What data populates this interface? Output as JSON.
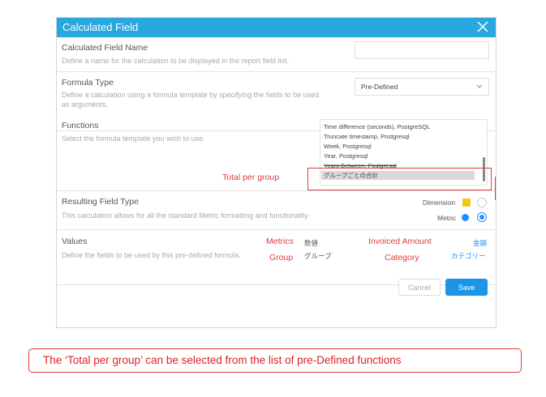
{
  "dialog": {
    "title": "Calculated Field",
    "close_icon": "close-icon",
    "accent_color": "#29a8e0"
  },
  "name_section": {
    "label": "Calculated Field Name",
    "description": "Define a name for the calculation to be displayed in the report field list.",
    "input_value": ""
  },
  "formula_section": {
    "label": "Formula Type",
    "description_line1": "Define a calculation using a formula template by specifying the fields to be used",
    "description_line2": "as arguments.",
    "selected": "Pre-Defined"
  },
  "functions_section": {
    "label": "Functions",
    "description": "Select the formula template you wish to use.",
    "items": [
      "Time difference (seconds), PostgreSQL",
      "Truncate timestamp, Postgresql",
      "Week, Postgresql",
      "Year, Postgresql",
      "Years Between, Postgresql",
      "グループごとの合計"
    ],
    "selected_item": "グループごとの合計"
  },
  "annotation": {
    "total_per_group": "Total per group",
    "color": "#e03c3c"
  },
  "result_section": {
    "label": "Resulting Field Type",
    "description": "This calculation allows for all the standard Metric formatting and functionality.",
    "options": [
      {
        "label": "Dimension",
        "icon_color": "#f5c518",
        "selected": false
      },
      {
        "label": "Metric",
        "icon_color": "#1e90ff",
        "selected": true
      }
    ]
  },
  "values_section": {
    "label": "Values",
    "description": "Define the fields to be used by this pre-defined formula.",
    "annotations": {
      "metrics": "Metrics",
      "group": "Group",
      "invoiced_amount": "Invoiced Amount",
      "category": "Category"
    },
    "arguments": {
      "metrics_jp": "数値",
      "group_jp": "グループ"
    },
    "fields": {
      "metrics_field": "金額",
      "group_field": "カテゴリー"
    }
  },
  "buttons": {
    "cancel": "Cancel",
    "save": "Save",
    "save_color": "#1a95e8"
  },
  "caption": {
    "text": "The ‘Total per group’ can be selected from the list of pre-Defined functions"
  }
}
